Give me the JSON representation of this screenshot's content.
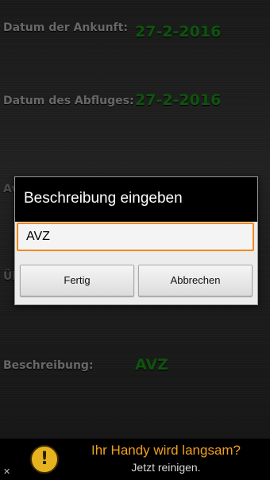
{
  "fields": {
    "arrival_label": "Datum der Ankunft:",
    "arrival_value": "27-2-2016",
    "departure_label": "Datum des Abfluges:",
    "departure_value": "27-2-2016",
    "hidden_label_1": "Av",
    "hidden_label_2": "Üb",
    "description_label": "Beschreibung:",
    "description_value": "AVZ"
  },
  "dialog": {
    "title": "Beschreibung eingeben",
    "input_value": "AVZ",
    "done_label": "Fertig",
    "cancel_label": "Abbrechen"
  },
  "ad": {
    "close": "✕",
    "icon_glyph": "!",
    "headline": "Ihr Handy wird langsam?",
    "subline": "Jetzt reinigen."
  },
  "colors": {
    "accent_green": "#1a9a1a",
    "input_focus_orange": "#f08a1c",
    "ad_headline_orange": "#f0a020"
  }
}
